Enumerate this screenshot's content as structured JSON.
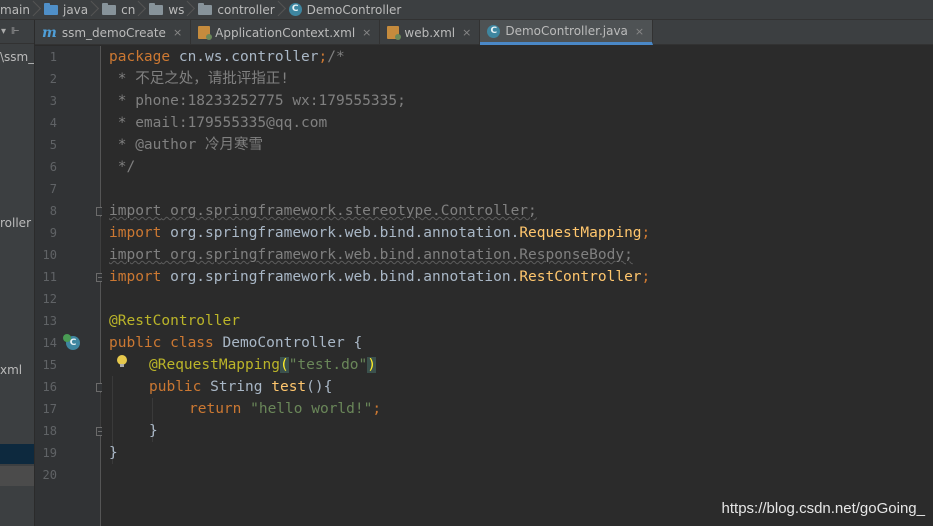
{
  "breadcrumb": [
    {
      "label": "main",
      "icon": "none"
    },
    {
      "label": "java",
      "icon": "folder-blue"
    },
    {
      "label": "cn",
      "icon": "folder"
    },
    {
      "label": "ws",
      "icon": "folder"
    },
    {
      "label": "controller",
      "icon": "folder"
    },
    {
      "label": "DemoController",
      "icon": "class"
    }
  ],
  "left_panel": {
    "items": [
      {
        "label": "\\ssm_"
      },
      {
        "label": "roller"
      },
      {
        "label": "xml"
      }
    ]
  },
  "tabs": [
    {
      "label": "ssm_demoCreate",
      "icon": "m-icon",
      "active": false
    },
    {
      "label": "ApplicationContext.xml",
      "icon": "xml-icon",
      "active": false
    },
    {
      "label": "web.xml",
      "icon": "xml-icon",
      "active": false
    },
    {
      "label": "DemoController.java",
      "icon": "class-icon",
      "active": true
    }
  ],
  "tab_close_glyph": "×",
  "line_numbers": [
    "1",
    "2",
    "3",
    "4",
    "5",
    "6",
    "7",
    "8",
    "9",
    "10",
    "11",
    "12",
    "13",
    "14",
    "15",
    "16",
    "17",
    "18",
    "19",
    "20"
  ],
  "code": {
    "l1": {
      "kw": "package",
      "pkg": " cn.ws.controller",
      "semi": ";",
      "cm": "/*"
    },
    "l2": " * 不足之处，请批评指正!",
    "l3": " * phone:18233252775 wx:179555335;",
    "l4": " * email:179555335@qq.com",
    "l5": " * @author 冷月寒雪",
    "l6": " */",
    "l8": {
      "kw": "import",
      "rest": " org.springframework.stereotype.Controller;"
    },
    "l9": {
      "kw": "import",
      "pkg": " org.springframework.web.bind.annotation.",
      "cls": "RequestMapping",
      "semi": ";"
    },
    "l10": {
      "kw": "import",
      "rest": " org.springframework.web.bind.annotation.ResponseBody;"
    },
    "l11": {
      "kw": "import",
      "pkg": " org.springframework.web.bind.annotation.",
      "cls": "RestController",
      "semi": ";"
    },
    "l13": "@RestController",
    "l14": {
      "kw": "public class",
      "name": " DemoController {"
    },
    "l15": {
      "ann": "@RequestMapping",
      "open": "(",
      "str": "\"test.do\"",
      "close": ")"
    },
    "l16": {
      "kw": "public",
      "type": " String ",
      "fn": "test",
      "rest": "(){"
    },
    "l17": {
      "kw": "return",
      "str": " \"hello world!\"",
      "semi": ";"
    },
    "l18": "}",
    "l19": "}"
  },
  "watermark": "https://blog.csdn.net/goGoing_",
  "colors": {
    "keyword": "#cc7832",
    "annotation": "#bbb529",
    "string": "#6a8759",
    "comment": "#808080",
    "method": "#ffc66d",
    "accent": "#4a88c7"
  }
}
